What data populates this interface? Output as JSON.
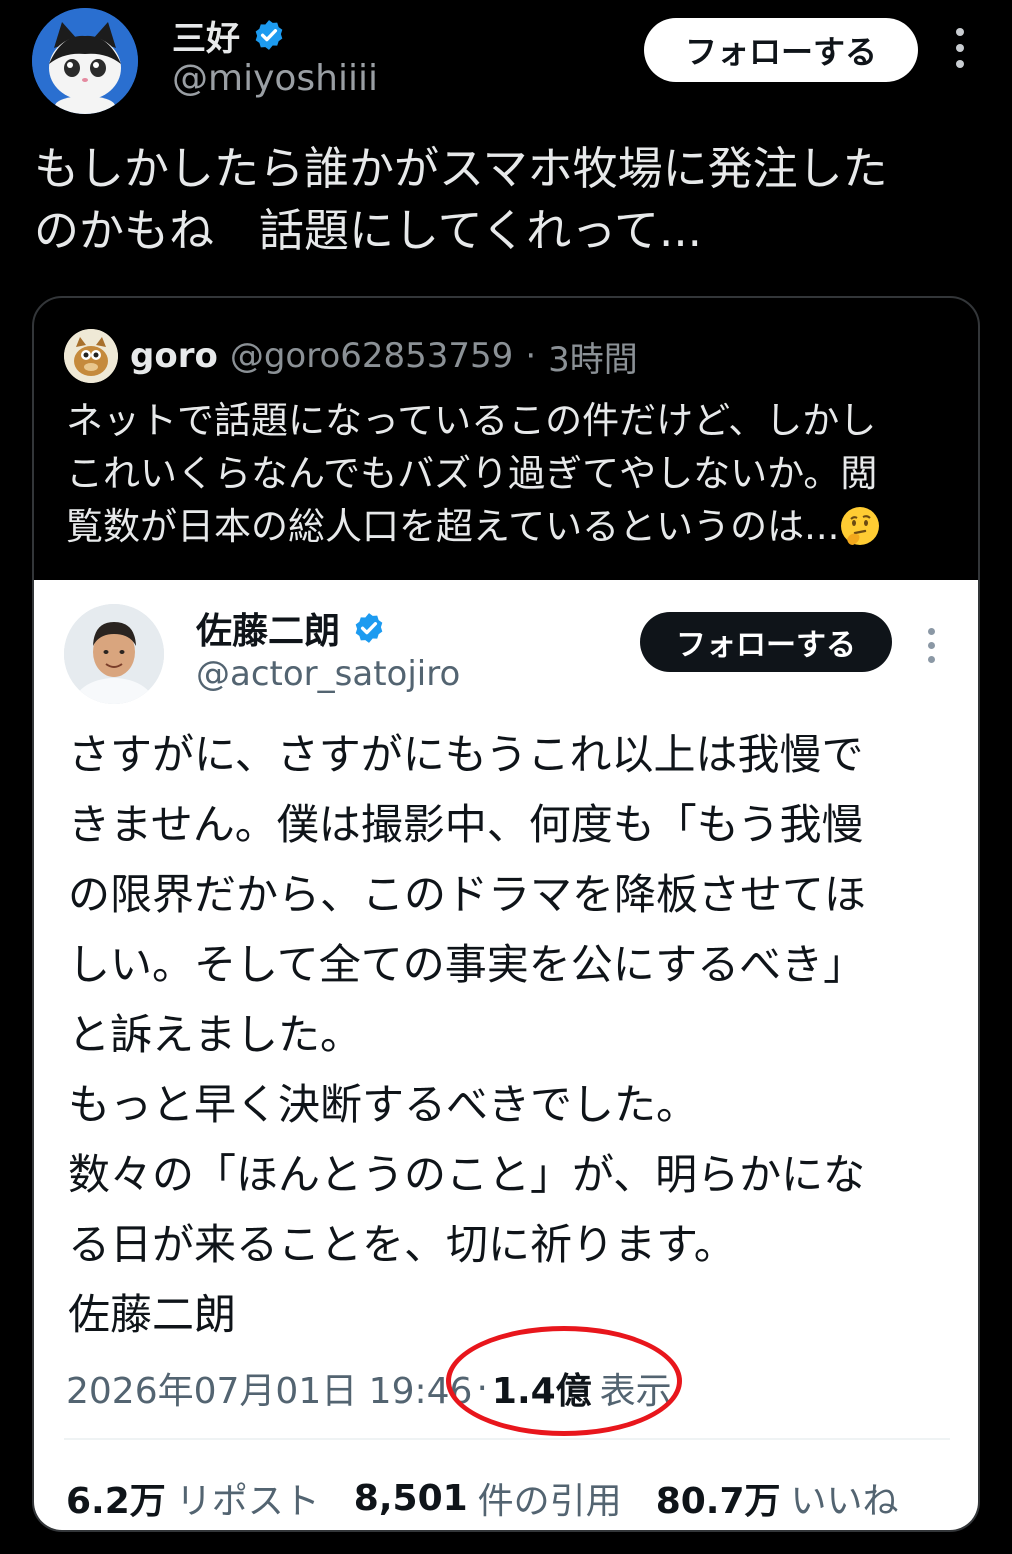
{
  "outer_post": {
    "display_name": "三好",
    "handle": "@miyoshiiii",
    "follow_label": "フォローする",
    "text": "もしかしたら誰かがスマホ牧場に発注した\nのかもね　話題にしてくれって..."
  },
  "quoted_post": {
    "display_name": "goro",
    "handle": "@goro62853759",
    "separator": "·",
    "time": "3時間",
    "text": "ネットで話題になっているこの件だけど、しかし\nこれいくらなんでもバズり過ぎてやしないか。閲\n覧数が日本の総人口を超えているというのは...",
    "emoji_icon": "thinking-face-icon"
  },
  "embedded_post": {
    "display_name": "佐藤二朗",
    "handle": "@actor_satojiro",
    "follow_label": "フォローする",
    "text": "さすがに、さすがにもうこれ以上は我慢で\nきません。僕は撮影中、何度も「もう我慢\nの限界だから、このドラマを降板させてほ\nしい。そして全ての事実を公にするべき」\nと訴えました。\nもっと早く決断するべきでした。\n数々の「ほんとうのこと」が、明らかにな\nる日が来ることを、切に祈ります。\n佐藤二朗",
    "timestamp": "2026年07月01日 19:46",
    "separator": "·",
    "views_count": "1.4億",
    "views_label": "表示",
    "stats": {
      "reposts_count": "6.2万",
      "reposts_label": "リポスト",
      "quotes_count": "8,501",
      "quotes_label": "件の引用",
      "likes_count": "80.7万",
      "likes_label": "いいね"
    }
  },
  "colors": {
    "background": "#000000",
    "verified_badge": "#1d9bf0",
    "highlight_circle": "#e8161c",
    "secondary_text_dark": "#9a9fa4",
    "secondary_text_light": "#536471"
  }
}
